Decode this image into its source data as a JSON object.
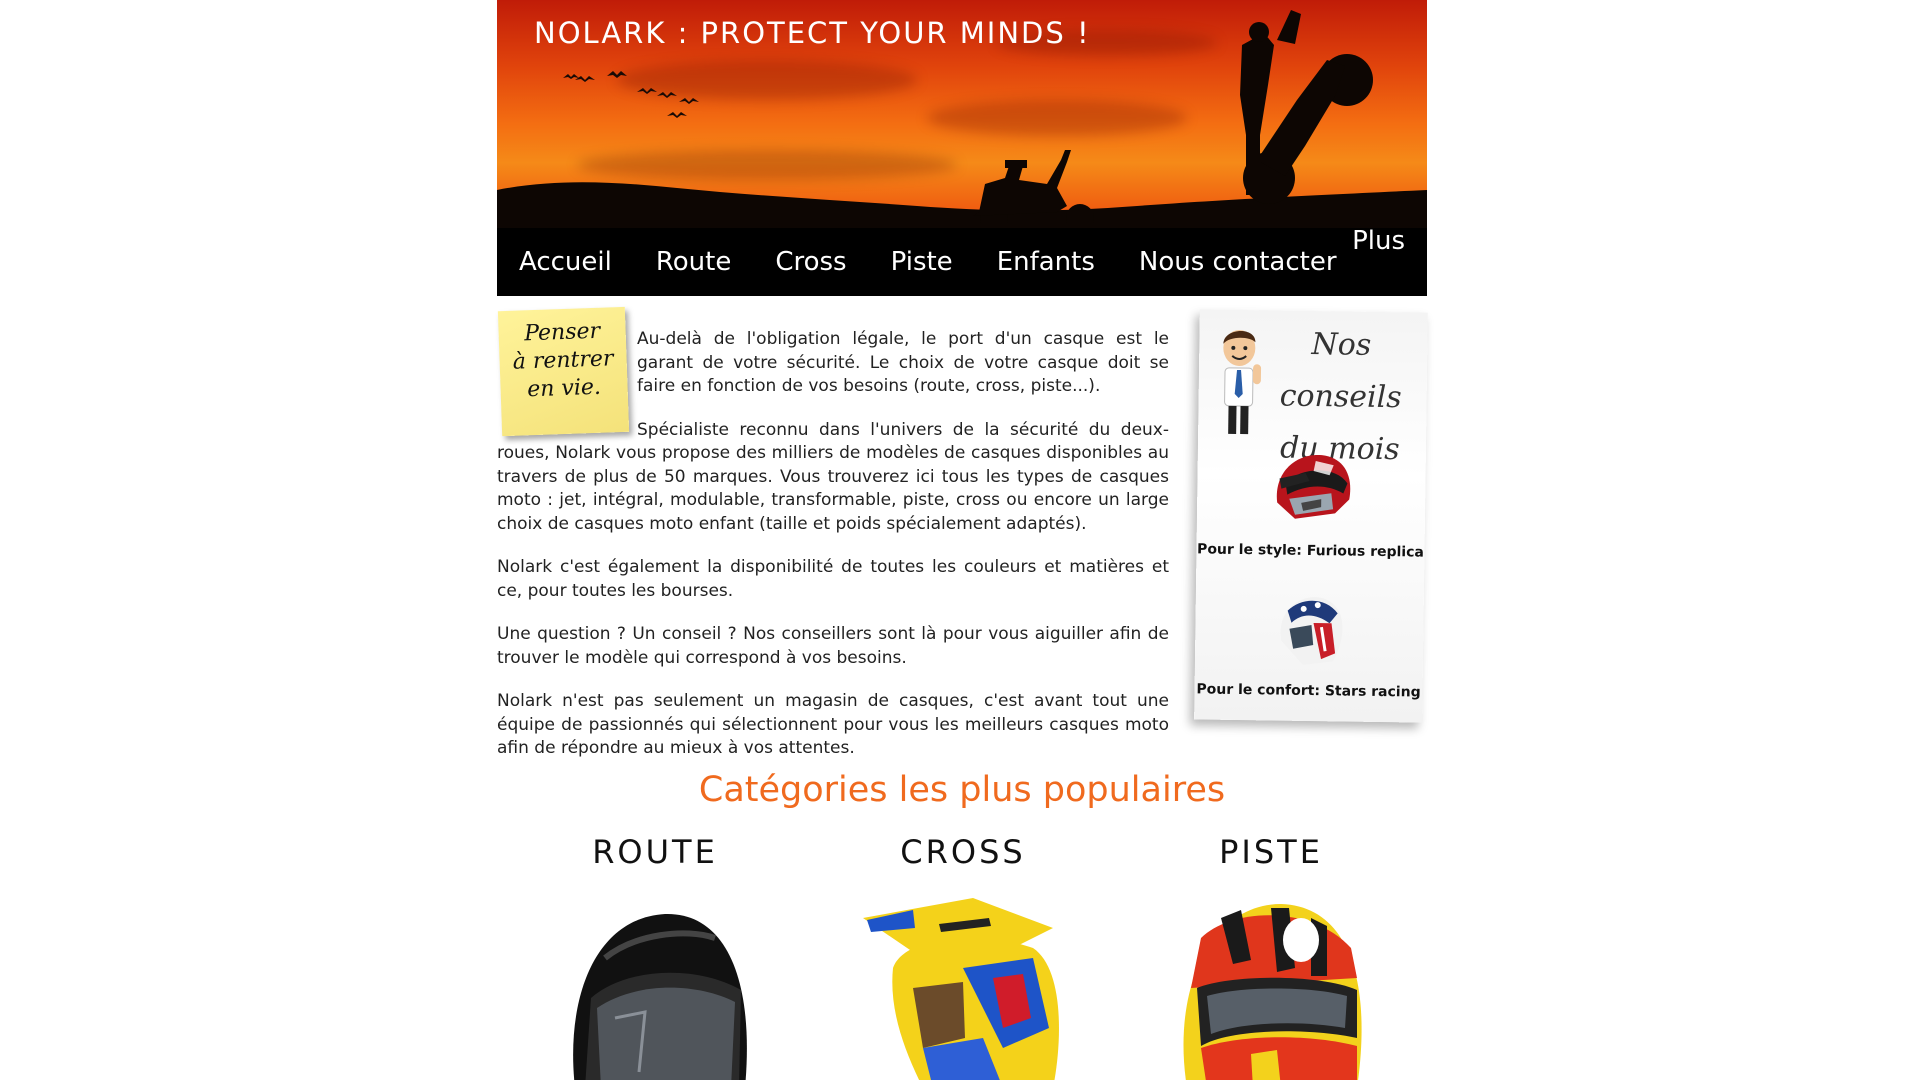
{
  "header": {
    "title": "NOLARK : PROTECT YOUR MINDS !"
  },
  "nav": {
    "items": [
      "Accueil",
      "Route",
      "Cross",
      "Piste",
      "Enfants",
      "Nous contacter"
    ],
    "more": "Plus"
  },
  "sticky_note": {
    "line1": "Penser",
    "line2": "à rentrer",
    "line3": "en vie."
  },
  "content": {
    "p1": "Au-delà de l'obligation légale, le port d'un casque est le garant de votre sécurité. Le choix de votre casque doit se faire en fonction de vos besoins (route, cross, piste...).",
    "p2": "Spécialiste reconnu dans l'univers de la sécurité du deux-roues, Nolark vous propose des milliers de modèles de casques disponibles au travers de plus de 50 marques. Vous trouverez ici tous les types de casques moto : jet, intégral, modulable, transformable, piste, cross ou encore un large choix de casques moto enfant (taille et poids spécialement adaptés).",
    "p3": "Nolark c'est également la disponibilité de toutes les couleurs et matières et ce, pour toutes les bourses.",
    "p4": "Une question ? Un conseil ? Nos conseillers sont là pour vous aiguiller afin de trouver le modèle qui correspond à vos besoins.",
    "p5": "Nolark n'est pas seulement un magasin de casques, c'est avant tout une équipe de passionnés qui sélectionnent pour vous les meilleurs casques moto afin de répondre au mieux à vos attentes."
  },
  "advice": {
    "title_line1": "Nos conseils",
    "title_line2": "du mois",
    "item1_caption": "Pour le style: Furious replica",
    "item2_caption": "Pour le confort: Stars racing"
  },
  "categories": {
    "title": "Catégories les plus populaires",
    "items": [
      "ROUTE",
      "CROSS",
      "PISTE"
    ]
  },
  "colors": {
    "accent": "#f06a1e",
    "nav_bg": "#000000",
    "sky_top": "#c01c08",
    "sky_mid": "#f58a18",
    "sticky": "#f4e27a"
  }
}
